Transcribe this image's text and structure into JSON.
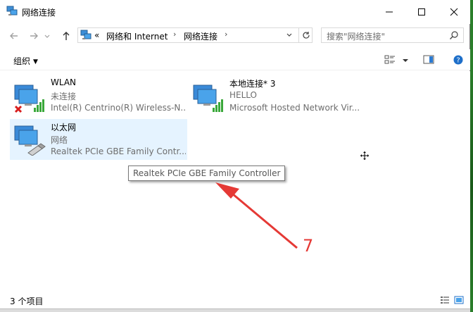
{
  "window": {
    "title": "网络连接",
    "minimize_glyph": "—",
    "maximize_glyph": "☐",
    "close_glyph": "✕"
  },
  "address": {
    "overflow": "«",
    "crumbs": [
      "网络和 Internet",
      "网络连接"
    ],
    "separator": "›"
  },
  "search": {
    "placeholder": "搜索\"网络连接\""
  },
  "toolbar": {
    "organize_label": "组织"
  },
  "connections": [
    {
      "name": "WLAN",
      "status": "未连接",
      "device": "Intel(R) Centrino(R) Wireless-N...",
      "kind": "wireless",
      "disconnected": true
    },
    {
      "name": "本地连接* 3",
      "status": "HELLO",
      "device": "Microsoft Hosted Network Vir...",
      "kind": "wireless",
      "disconnected": false
    },
    {
      "name": "以太网",
      "status": "网络",
      "device": "Realtek PCIe GBE Family Contr...",
      "kind": "ethernet",
      "disconnected": false,
      "selected": true
    }
  ],
  "tooltip": {
    "text": "Realtek PCIe GBE Family Controller"
  },
  "annotation": {
    "number": "7",
    "color": "#e53935"
  },
  "statusbar": {
    "item_count": "3 个项目"
  },
  "colors": {
    "selection": "#e5f3ff",
    "signal_green": "#3aa83a",
    "error_red": "#d81e1e"
  }
}
